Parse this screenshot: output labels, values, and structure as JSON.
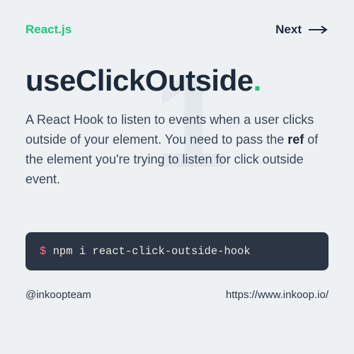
{
  "header": {
    "brand": "React.js",
    "next_label": "Next"
  },
  "background_number": "1",
  "title": {
    "text": "useClickOutside",
    "dot": "."
  },
  "description": {
    "part1": "A React Hook to listen to events when a user clicks outside of your element. You need to pass the ",
    "bold": "ref",
    "part2": " of the element you're trying to listen for click outside event."
  },
  "code": {
    "prompt": "$",
    "command": " npm i react-click-outside-hook"
  },
  "footer": {
    "handle": "@inkoopteam",
    "url": "https://www.inkoop.io/"
  }
}
